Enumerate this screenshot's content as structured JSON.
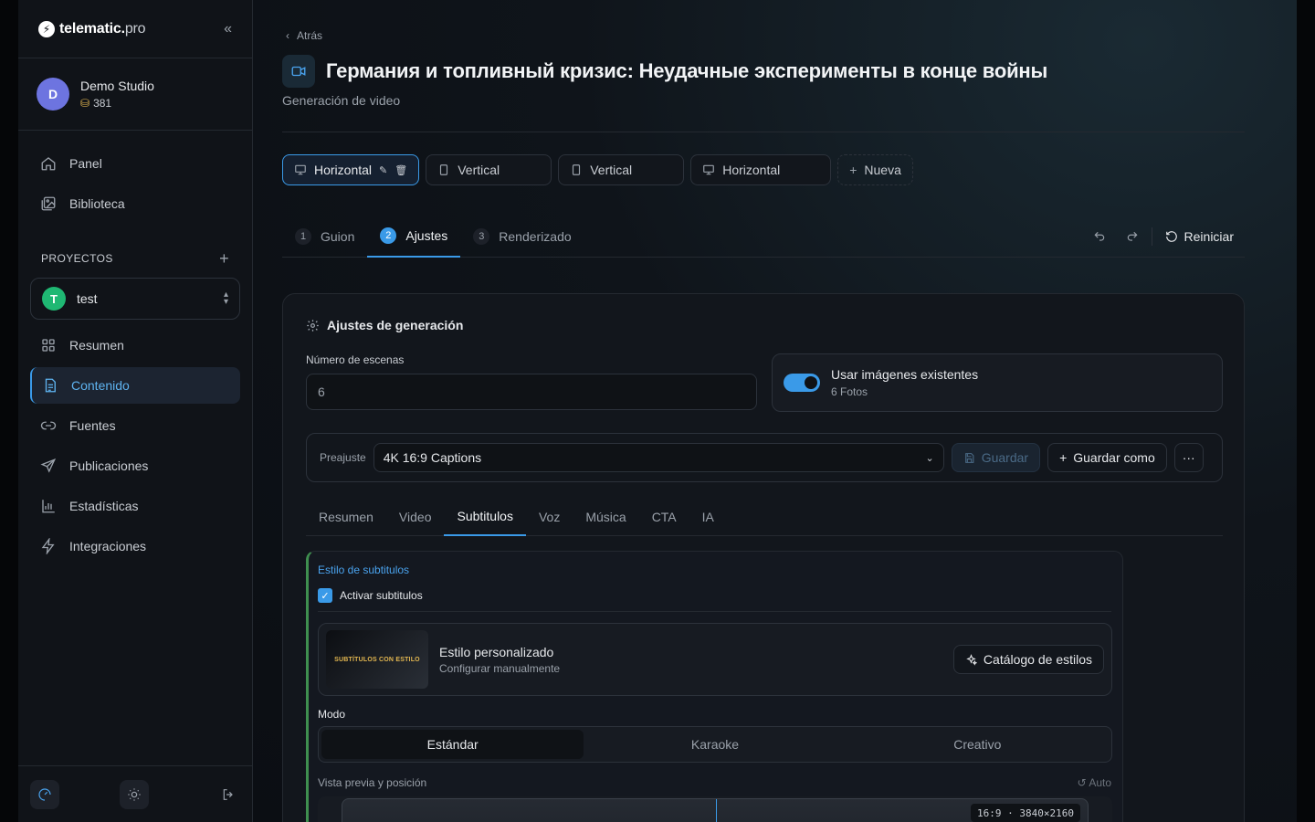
{
  "sidebar": {
    "brand": {
      "name": "telematic.",
      "suffix": "pro"
    },
    "org": {
      "avatar": "D",
      "name": "Demo Studio",
      "credits": "381"
    },
    "nav": [
      {
        "label": "Panel",
        "icon": "home-icon"
      },
      {
        "label": "Biblioteca",
        "icon": "image-library-icon"
      }
    ],
    "projects_heading": "PROYECTOS",
    "project": {
      "avatar": "T",
      "name": "test"
    },
    "project_nav": [
      {
        "label": "Resumen",
        "icon": "grid-icon",
        "active": false
      },
      {
        "label": "Contenido",
        "icon": "document-icon",
        "active": true
      },
      {
        "label": "Fuentes",
        "icon": "link-icon",
        "active": false
      },
      {
        "label": "Publicaciones",
        "icon": "send-icon",
        "active": false
      },
      {
        "label": "Estadísticas",
        "icon": "bar-chart-icon",
        "active": false
      },
      {
        "label": "Integraciones",
        "icon": "bolt-icon",
        "active": false
      }
    ]
  },
  "header": {
    "back": "Atrás",
    "title": "Германия и топливный кризис: Неудачные эксперименты в конце войны",
    "subtitle": "Generación de video"
  },
  "variants": [
    {
      "label": "Horizontal",
      "icon": "monitor-icon",
      "active": true
    },
    {
      "label": "Vertical",
      "icon": "phone-icon",
      "active": false
    },
    {
      "label": "Vertical",
      "icon": "phone-icon",
      "active": false
    },
    {
      "label": "Horizontal",
      "icon": "monitor-icon",
      "active": false
    }
  ],
  "new_variant": "Nueva",
  "steps": [
    {
      "num": "1",
      "label": "Guion",
      "active": false
    },
    {
      "num": "2",
      "label": "Ajustes",
      "active": true
    },
    {
      "num": "3",
      "label": "Renderizado",
      "active": false
    }
  ],
  "restart_label": "Reiniciar",
  "settings": {
    "heading": "Ajustes de generación",
    "scenes_label": "Número de escenas",
    "scenes_placeholder": "6",
    "use_images_title": "Usar imágenes existentes",
    "use_images_sub": "6 Fotos",
    "use_images_on": true,
    "preset_label": "Preajuste",
    "preset_value": "4K 16:9 Captions",
    "save_label": "Guardar",
    "save_as_label": "Guardar como",
    "tabs": [
      "Resumen",
      "Video",
      "Subtitulos",
      "Voz",
      "Música",
      "CTA",
      "IA"
    ],
    "active_tab": "Subtitulos"
  },
  "subtitles": {
    "section_title": "Estilo de subtitulos",
    "enable_label": "Activar subtitulos",
    "enabled": true,
    "thumb_text": "SUBTÍTULOS CON ESTILO",
    "style_title": "Estilo personalizado",
    "style_sub": "Configurar manualmente",
    "catalog_label": "Catálogo de estilos",
    "mode_label": "Modo",
    "modes": [
      "Estándar",
      "Karaoke",
      "Creativo"
    ],
    "active_mode": "Estándar",
    "preview_label": "Vista previa y posición",
    "auto_label": "Auto",
    "resolution_badge": "16:9 · 3840×2160"
  },
  "colors": {
    "accent": "#3a9ae8",
    "success": "#1fb873",
    "panel_accent": "#3f8f4f"
  }
}
